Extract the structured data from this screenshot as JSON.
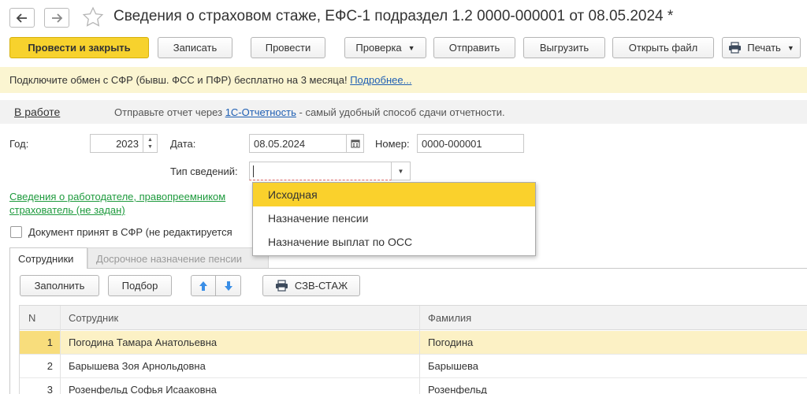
{
  "header": {
    "title": "Сведения о страховом стаже, ЕФС-1 подраздел 1.2 0000-000001 от 08.05.2024 *"
  },
  "toolbar": {
    "post_close": "Провести и закрыть",
    "save": "Записать",
    "post": "Провести",
    "check": "Проверка",
    "send": "Отправить",
    "upload": "Выгрузить",
    "open_file": "Открыть файл",
    "print": "Печать"
  },
  "promo": {
    "text": "Подключите обмен с СФР (бывш. ФСС и ПФР) бесплатно на 3 месяца!",
    "link": "Подробнее..."
  },
  "status": {
    "state": "В работе",
    "hint_before": "Отправьте отчет через",
    "hint_link": "1С-Отчетность",
    "hint_after": "- самый удобный способ сдачи отчетности."
  },
  "form": {
    "year_label": "Год:",
    "year_value": "2023",
    "date_label": "Дата:",
    "date_value": "08.05.2024",
    "number_label": "Номер:",
    "number_value": "0000-000001",
    "type_label": "Тип сведений:",
    "employer_link_line1": "Сведения о работодателе, правопреемником",
    "employer_link_line2": "страхователь (не задан)",
    "accepted_label": "Документ принят в СФР (не редактируется"
  },
  "dropdown": {
    "options": [
      "Исходная",
      "Назначение пенсии",
      "Назначение выплат по ОСС"
    ],
    "selected_index": 0
  },
  "tabs": {
    "employees": "Сотрудники",
    "early_pension": "Досрочное назначение пенсии"
  },
  "subtoolbar": {
    "fill": "Заполнить",
    "pick": "Подбор",
    "szv": "СЗВ-СТАЖ"
  },
  "table": {
    "headers": {
      "n": "N",
      "employee": "Сотрудник",
      "surname": "Фамилия"
    },
    "rows": [
      {
        "n": "1",
        "employee": "Погодина Тамара Анатольевна",
        "surname": "Погодина"
      },
      {
        "n": "2",
        "employee": "Барышева Зоя Арнольдовна",
        "surname": "Барышева"
      },
      {
        "n": "3",
        "employee": "Розенфельд Софья Исааковна",
        "surname": "Розенфельд"
      }
    ]
  },
  "colors": {
    "accent_yellow": "#f7d22d",
    "promo_bg": "#fbf5d1",
    "link_blue": "#1f5fb3",
    "link_green": "#1e9a3d",
    "arrow_blue": "#3a8ee6"
  }
}
